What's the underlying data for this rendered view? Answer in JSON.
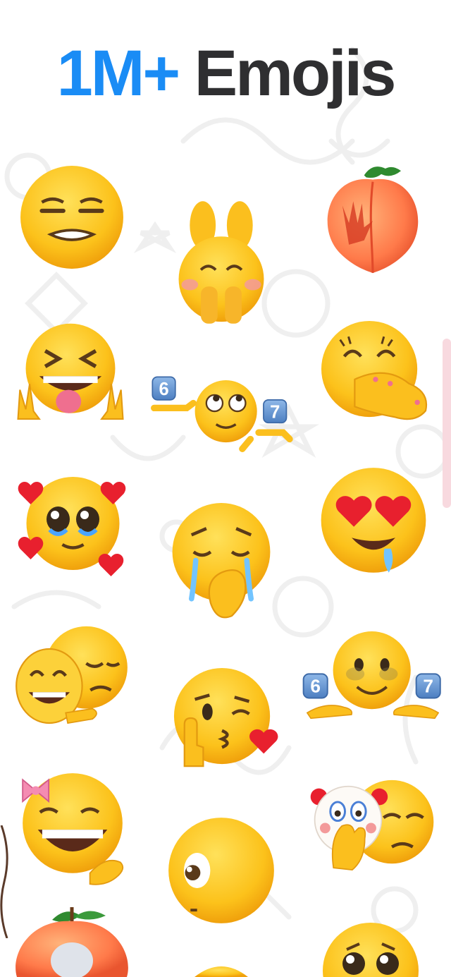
{
  "headline": {
    "accent": "1M+",
    "rest": " Emojis"
  },
  "colors": {
    "accent": "#1a8cf5",
    "title": "#2f2f31",
    "emoji_face": "#fcc21b",
    "heart": "#e8202e",
    "blush": "#f39a9a"
  },
  "badges": {
    "six": "6",
    "seven": "7"
  },
  "emojis": [
    "smirking-face",
    "face-behind-feet",
    "peach-with-hand",
    "squinting-tongue-peace",
    "rolling-eyes-shrug",
    "hand-over-mouth-giggle",
    "pleading-face-hearts",
    "sad-face-crying-hand",
    "heart-eyes-drooling",
    "laughing-mask-sad-face",
    "kissing-wink-heart",
    "six-seven-smiling-face",
    "grinning-face-bow",
    "side-eye-face",
    "clown-and-sad-face",
    "peach",
    "pleading-face"
  ]
}
